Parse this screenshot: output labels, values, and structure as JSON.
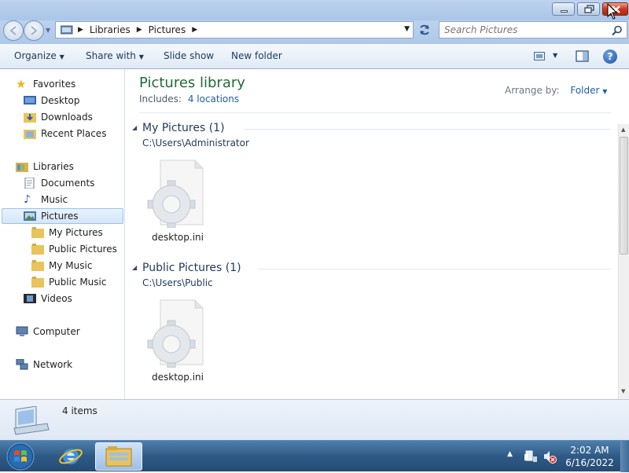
{
  "window": {
    "buttons": [
      "minimize",
      "restore",
      "close"
    ]
  },
  "address": {
    "crumbs": [
      "Libraries",
      "Pictures"
    ],
    "search_placeholder": "Search Pictures"
  },
  "toolbar": {
    "organize": "Organize",
    "share_with": "Share with",
    "slide_show": "Slide show",
    "new_folder": "New folder"
  },
  "sidebar": {
    "favorites": "Favorites",
    "desktop": "Desktop",
    "downloads": "Downloads",
    "recent_places": "Recent Places",
    "libraries": "Libraries",
    "documents": "Documents",
    "music": "Music",
    "pictures": "Pictures",
    "my_pictures": "My Pictures",
    "public_pictures": "Public Pictures",
    "my_music": "My Music",
    "public_music": "Public Music",
    "videos": "Videos",
    "computer": "Computer",
    "network": "Network"
  },
  "library": {
    "title": "Pictures library",
    "includes_label": "Includes:",
    "locations": "4 locations",
    "arrange_label": "Arrange by:",
    "arrange_value": "Folder"
  },
  "groups": [
    {
      "title": "My Pictures (1)",
      "path": "C:\\Users\\Administrator",
      "file": "desktop.ini"
    },
    {
      "title": "Public Pictures (1)",
      "path": "C:\\Users\\Public",
      "file": "desktop.ini"
    }
  ],
  "status": {
    "count": "4 items"
  },
  "clock": {
    "time": "2:02 AM",
    "date": "6/16/2022"
  },
  "colors": {
    "title_green": "#1f6b3a",
    "link_blue": "#1e5fa8",
    "header_blue": "#1e395b"
  }
}
